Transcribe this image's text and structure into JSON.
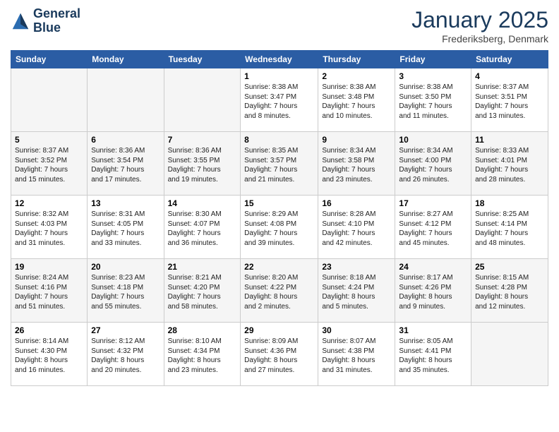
{
  "logo": {
    "line1": "General",
    "line2": "Blue"
  },
  "title": "January 2025",
  "location": "Frederiksberg, Denmark",
  "weekdays": [
    "Sunday",
    "Monday",
    "Tuesday",
    "Wednesday",
    "Thursday",
    "Friday",
    "Saturday"
  ],
  "weeks": [
    [
      {
        "day": "",
        "info": ""
      },
      {
        "day": "",
        "info": ""
      },
      {
        "day": "",
        "info": ""
      },
      {
        "day": "1",
        "info": "Sunrise: 8:38 AM\nSunset: 3:47 PM\nDaylight: 7 hours\nand 8 minutes."
      },
      {
        "day": "2",
        "info": "Sunrise: 8:38 AM\nSunset: 3:48 PM\nDaylight: 7 hours\nand 10 minutes."
      },
      {
        "day": "3",
        "info": "Sunrise: 8:38 AM\nSunset: 3:50 PM\nDaylight: 7 hours\nand 11 minutes."
      },
      {
        "day": "4",
        "info": "Sunrise: 8:37 AM\nSunset: 3:51 PM\nDaylight: 7 hours\nand 13 minutes."
      }
    ],
    [
      {
        "day": "5",
        "info": "Sunrise: 8:37 AM\nSunset: 3:52 PM\nDaylight: 7 hours\nand 15 minutes."
      },
      {
        "day": "6",
        "info": "Sunrise: 8:36 AM\nSunset: 3:54 PM\nDaylight: 7 hours\nand 17 minutes."
      },
      {
        "day": "7",
        "info": "Sunrise: 8:36 AM\nSunset: 3:55 PM\nDaylight: 7 hours\nand 19 minutes."
      },
      {
        "day": "8",
        "info": "Sunrise: 8:35 AM\nSunset: 3:57 PM\nDaylight: 7 hours\nand 21 minutes."
      },
      {
        "day": "9",
        "info": "Sunrise: 8:34 AM\nSunset: 3:58 PM\nDaylight: 7 hours\nand 23 minutes."
      },
      {
        "day": "10",
        "info": "Sunrise: 8:34 AM\nSunset: 4:00 PM\nDaylight: 7 hours\nand 26 minutes."
      },
      {
        "day": "11",
        "info": "Sunrise: 8:33 AM\nSunset: 4:01 PM\nDaylight: 7 hours\nand 28 minutes."
      }
    ],
    [
      {
        "day": "12",
        "info": "Sunrise: 8:32 AM\nSunset: 4:03 PM\nDaylight: 7 hours\nand 31 minutes."
      },
      {
        "day": "13",
        "info": "Sunrise: 8:31 AM\nSunset: 4:05 PM\nDaylight: 7 hours\nand 33 minutes."
      },
      {
        "day": "14",
        "info": "Sunrise: 8:30 AM\nSunset: 4:07 PM\nDaylight: 7 hours\nand 36 minutes."
      },
      {
        "day": "15",
        "info": "Sunrise: 8:29 AM\nSunset: 4:08 PM\nDaylight: 7 hours\nand 39 minutes."
      },
      {
        "day": "16",
        "info": "Sunrise: 8:28 AM\nSunset: 4:10 PM\nDaylight: 7 hours\nand 42 minutes."
      },
      {
        "day": "17",
        "info": "Sunrise: 8:27 AM\nSunset: 4:12 PM\nDaylight: 7 hours\nand 45 minutes."
      },
      {
        "day": "18",
        "info": "Sunrise: 8:25 AM\nSunset: 4:14 PM\nDaylight: 7 hours\nand 48 minutes."
      }
    ],
    [
      {
        "day": "19",
        "info": "Sunrise: 8:24 AM\nSunset: 4:16 PM\nDaylight: 7 hours\nand 51 minutes."
      },
      {
        "day": "20",
        "info": "Sunrise: 8:23 AM\nSunset: 4:18 PM\nDaylight: 7 hours\nand 55 minutes."
      },
      {
        "day": "21",
        "info": "Sunrise: 8:21 AM\nSunset: 4:20 PM\nDaylight: 7 hours\nand 58 minutes."
      },
      {
        "day": "22",
        "info": "Sunrise: 8:20 AM\nSunset: 4:22 PM\nDaylight: 8 hours\nand 2 minutes."
      },
      {
        "day": "23",
        "info": "Sunrise: 8:18 AM\nSunset: 4:24 PM\nDaylight: 8 hours\nand 5 minutes."
      },
      {
        "day": "24",
        "info": "Sunrise: 8:17 AM\nSunset: 4:26 PM\nDaylight: 8 hours\nand 9 minutes."
      },
      {
        "day": "25",
        "info": "Sunrise: 8:15 AM\nSunset: 4:28 PM\nDaylight: 8 hours\nand 12 minutes."
      }
    ],
    [
      {
        "day": "26",
        "info": "Sunrise: 8:14 AM\nSunset: 4:30 PM\nDaylight: 8 hours\nand 16 minutes."
      },
      {
        "day": "27",
        "info": "Sunrise: 8:12 AM\nSunset: 4:32 PM\nDaylight: 8 hours\nand 20 minutes."
      },
      {
        "day": "28",
        "info": "Sunrise: 8:10 AM\nSunset: 4:34 PM\nDaylight: 8 hours\nand 23 minutes."
      },
      {
        "day": "29",
        "info": "Sunrise: 8:09 AM\nSunset: 4:36 PM\nDaylight: 8 hours\nand 27 minutes."
      },
      {
        "day": "30",
        "info": "Sunrise: 8:07 AM\nSunset: 4:38 PM\nDaylight: 8 hours\nand 31 minutes."
      },
      {
        "day": "31",
        "info": "Sunrise: 8:05 AM\nSunset: 4:41 PM\nDaylight: 8 hours\nand 35 minutes."
      },
      {
        "day": "",
        "info": ""
      }
    ]
  ]
}
